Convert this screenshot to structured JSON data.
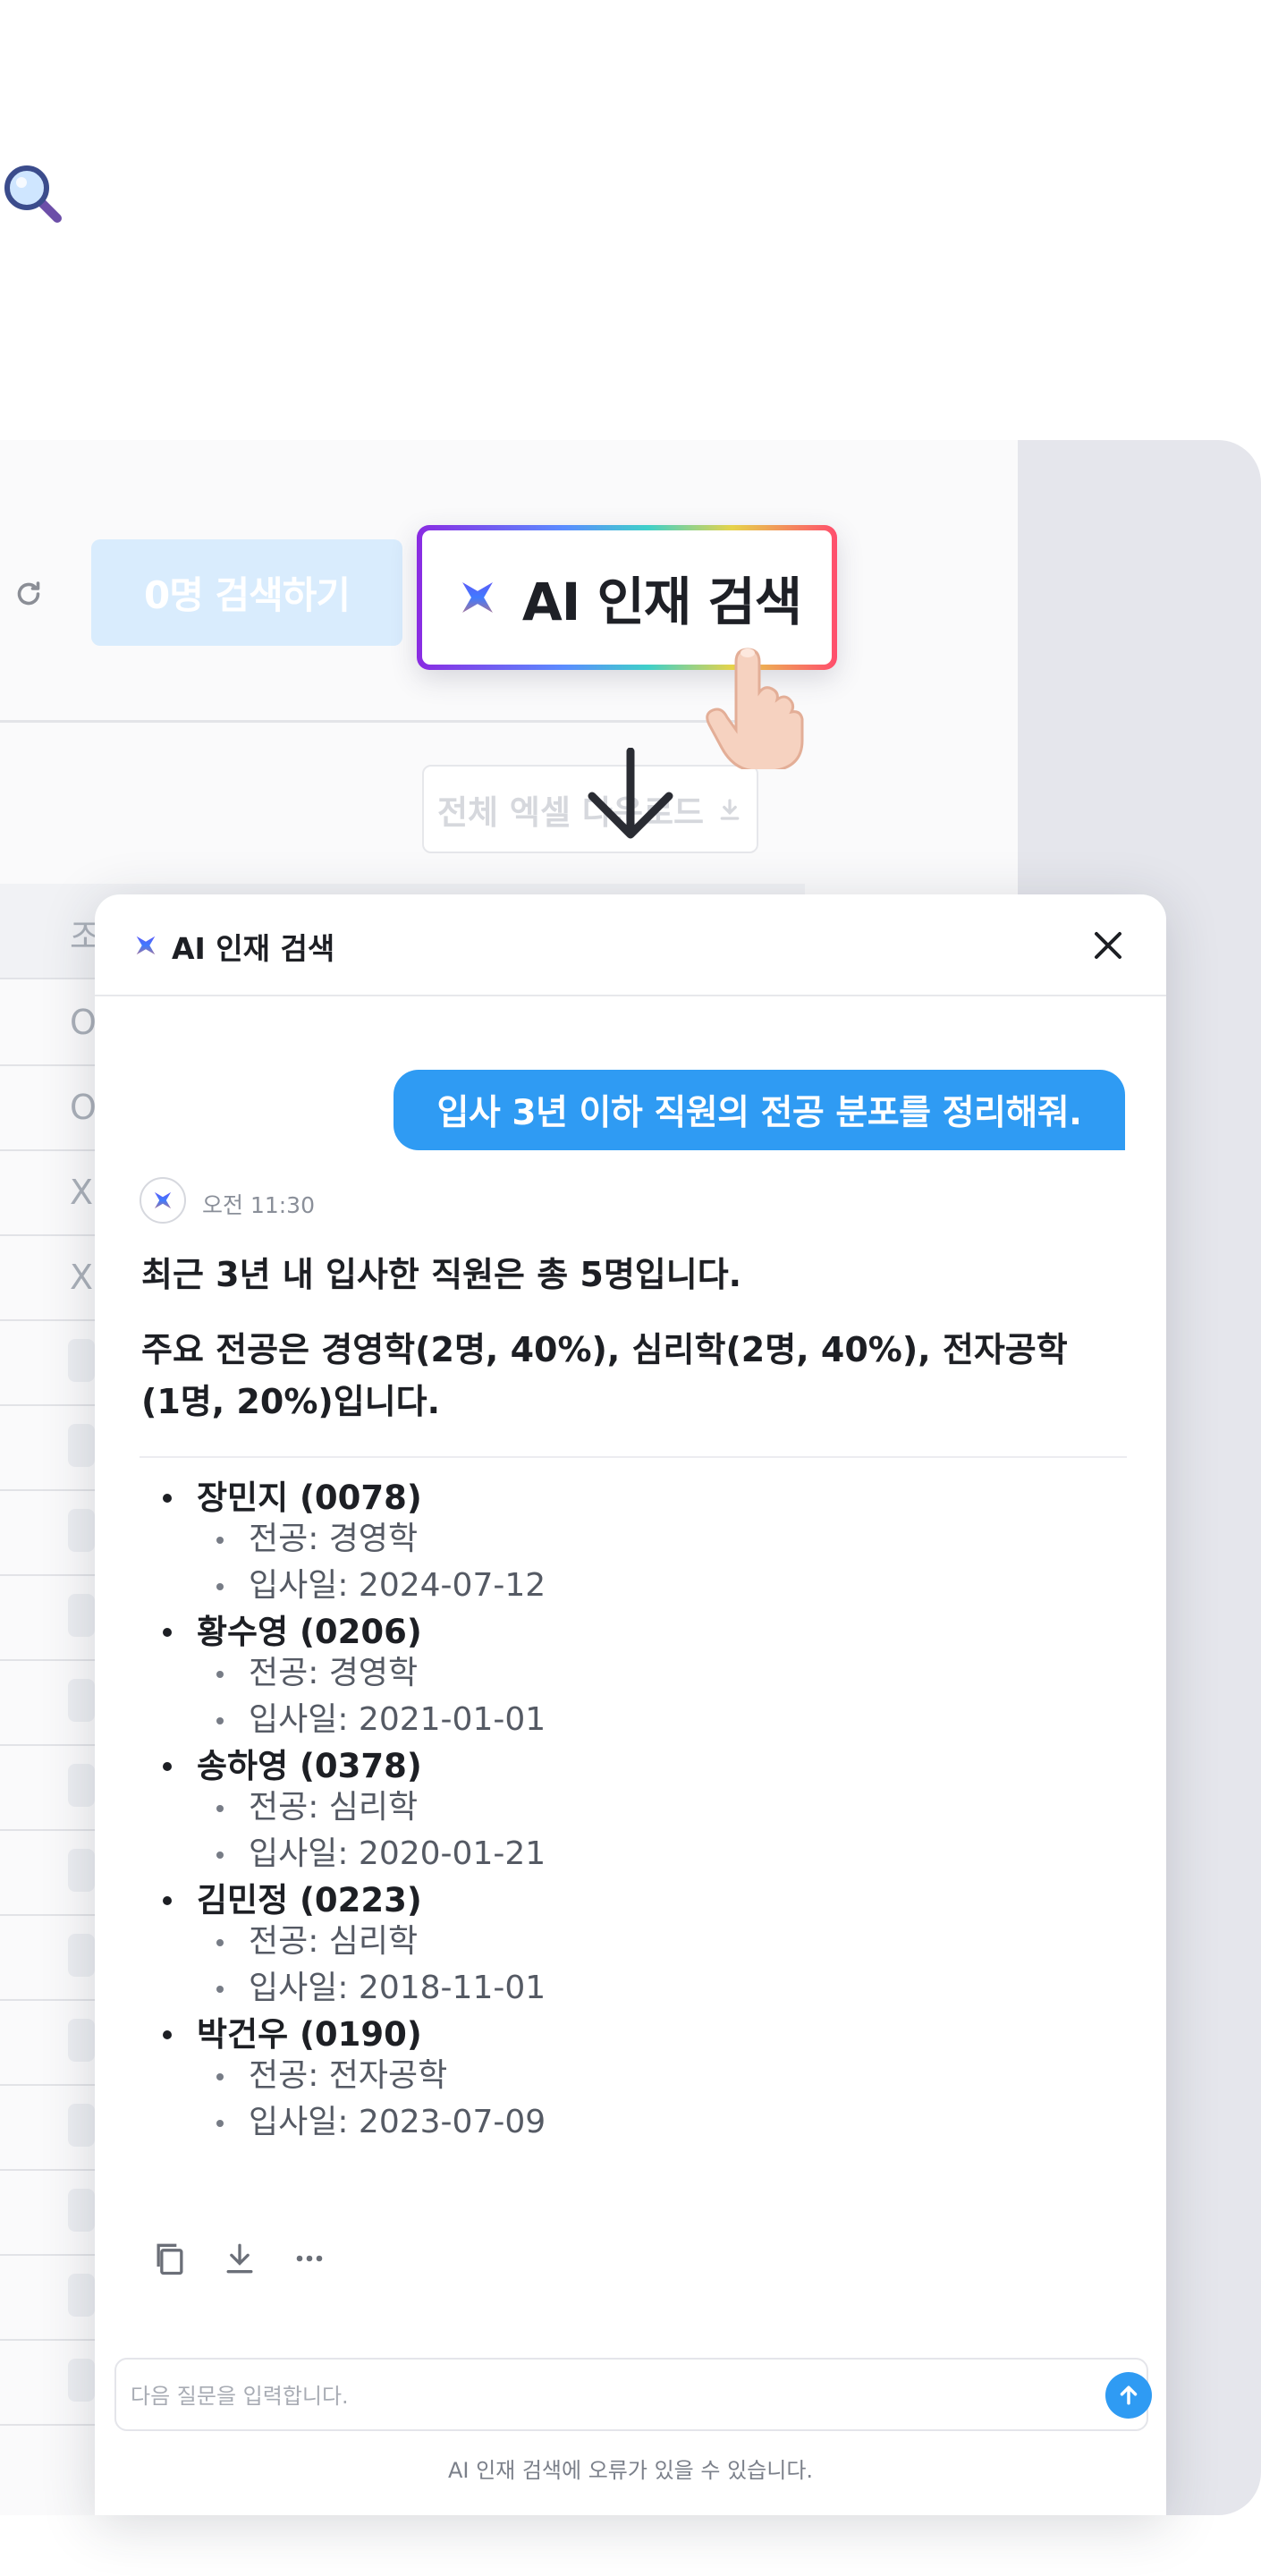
{
  "background": {
    "search_count_button": "0명 검색하기",
    "excel_download_button": "전체 엑셀 다운로드",
    "table_cells": [
      "조",
      "O",
      "O",
      "X",
      "X"
    ]
  },
  "ai_search_button": {
    "label": "AI 인재 검색",
    "icon": "sparkle-star-icon"
  },
  "dialog": {
    "title": "AI 인재 검색",
    "close_icon": "close-icon",
    "user_message": "입사 3년 이하 직원의 전공 분포를 정리해줘.",
    "bot": {
      "time": "오전 11:30",
      "summary": "최근 3년 내 입사한 직원은 총 5명입니다.",
      "detail": "주요 전공은 경영학(2명, 40%), 심리학(2명, 40%), 전자공학(1명, 20%)입니다.",
      "employees": [
        {
          "name": "장민지 (0078)",
          "major": "전공: 경영학",
          "joined": "입사일: 2024-07-12"
        },
        {
          "name": "황수영 (0206)",
          "major": "전공: 경영학",
          "joined": "입사일: 2021-01-01"
        },
        {
          "name": "송하영 (0378)",
          "major": "전공: 심리학",
          "joined": "입사일: 2020-01-21"
        },
        {
          "name": "김민정 (0223)",
          "major": "전공: 심리학",
          "joined": "입사일: 2018-11-01"
        },
        {
          "name": "박건우 (0190)",
          "major": "전공: 전자공학",
          "joined": "입사일: 2023-07-09"
        }
      ],
      "actions": [
        "copy-icon",
        "download-icon",
        "more-icon"
      ]
    },
    "input": {
      "placeholder": "다음 질문을 입력합니다.",
      "value": ""
    },
    "disclaimer": "AI 인재 검색에 오류가 있을 수 있습니다."
  },
  "colors": {
    "accent": "#2f9bf3",
    "side_panel": "#e5e6ec"
  }
}
